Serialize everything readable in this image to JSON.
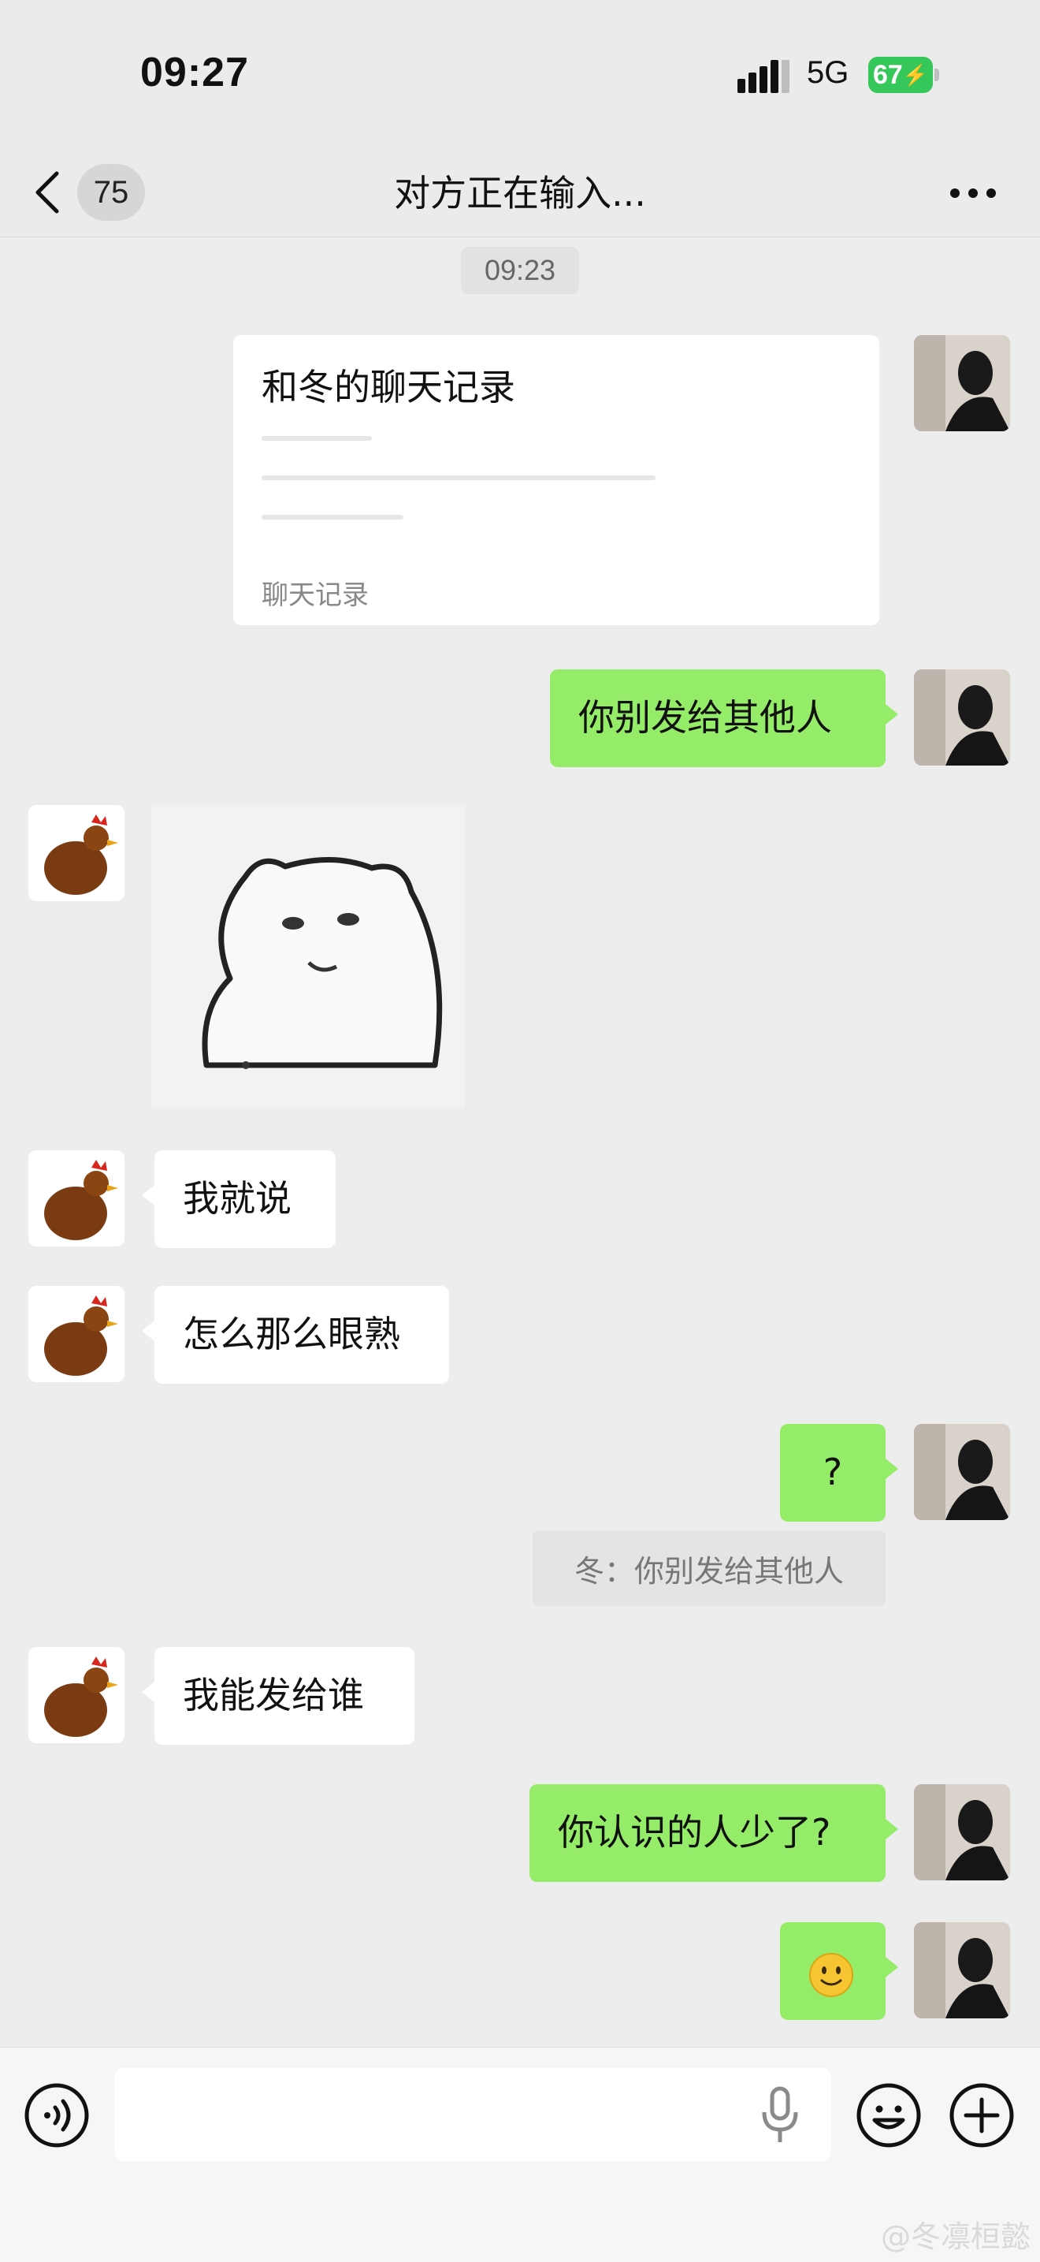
{
  "status_bar": {
    "time": "09:27",
    "network": "5G",
    "battery": "67"
  },
  "nav": {
    "back_count": "75",
    "title": "对方正在输入..."
  },
  "chat": {
    "timestamp": "09:23",
    "chat_record": {
      "title": "和冬的聊天记录",
      "footer": "聊天记录"
    },
    "messages": [
      {
        "from": "me",
        "text": "你别发给其他人"
      },
      {
        "from": "other",
        "type": "sticker"
      },
      {
        "from": "other",
        "text": "我就说"
      },
      {
        "from": "other",
        "text": "怎么那么眼熟"
      },
      {
        "from": "me",
        "text": "?"
      },
      {
        "from": "other",
        "text": "我能发给谁"
      },
      {
        "from": "me",
        "text": "你认识的人少了?"
      },
      {
        "from": "me",
        "type": "emoji",
        "emoji": "smile"
      }
    ],
    "quote": "冬：你别发给其他人"
  },
  "input_bar": {
    "voice_icon": "voice-icon",
    "emoji_icon": "emoji-icon",
    "plus_icon": "plus-icon",
    "mic_icon": "microphone-icon"
  },
  "watermark": "@冬凛桓懿",
  "colors": {
    "my_bubble": "#95ec69",
    "other_bubble": "#ffffff",
    "background": "#ededed"
  }
}
